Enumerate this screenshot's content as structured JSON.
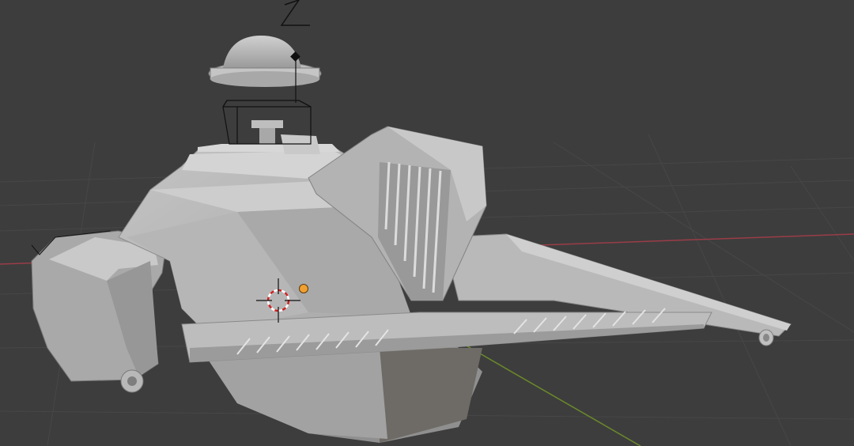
{
  "app": "Blender",
  "viewport": {
    "background": "#3d3d3d",
    "grid_color": "#4a4a4a",
    "x_axis_color": "#9a3d47",
    "y_axis_color": "#6b8a2a",
    "axis_gizmo_label": "Z",
    "object_color": "#b4b4b4",
    "origin_color": "#f0a030",
    "cursor_colors": [
      "#cc2222",
      "#ffffff"
    ]
  }
}
